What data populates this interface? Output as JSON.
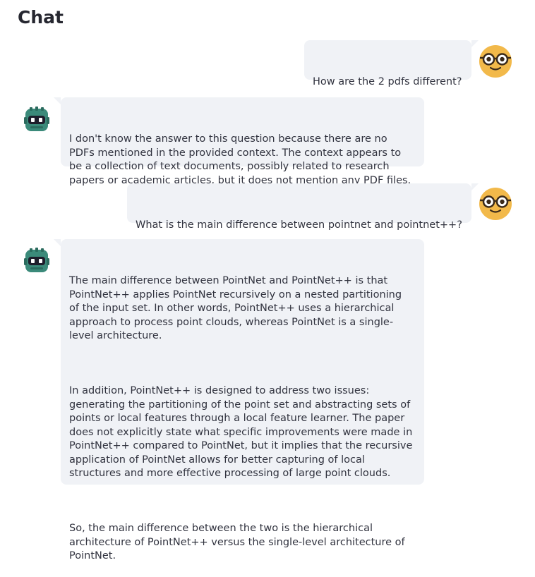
{
  "page": {
    "title": "Chat"
  },
  "colors": {
    "bubble_bg": "#f0f2f6",
    "user_avatar_face": "#f2b94a",
    "bot_avatar_face": "#3b8a7a",
    "text": "#31333f"
  },
  "messages": [
    {
      "role": "user",
      "avatar_icon": "nerd-glasses-face-icon",
      "paragraphs": [
        "How are the 2 pdfs different?"
      ]
    },
    {
      "role": "assistant",
      "avatar_icon": "robot-face-icon",
      "paragraphs": [
        "I don't know the answer to this question because there are no\nPDFs mentioned in the provided context. The context appears to\nbe a collection of text documents, possibly related to research\npapers or academic articles, but it does not mention any PDF files."
      ]
    },
    {
      "role": "user",
      "avatar_icon": "nerd-glasses-face-icon",
      "paragraphs": [
        "What is the main difference between pointnet and pointnet++?"
      ]
    },
    {
      "role": "assistant",
      "avatar_icon": "robot-face-icon",
      "paragraphs": [
        "The main difference between PointNet and PointNet++ is that\nPointNet++ applies PointNet recursively on a nested partitioning\nof the input set. In other words, PointNet++ uses a hierarchical\napproach to process point clouds, whereas PointNet is a single-\nlevel architecture.",
        "In addition, PointNet++ is designed to address two issues:\ngenerating the partitioning of the point set and abstracting sets of\npoints or local features through a local feature learner. The paper\ndoes not explicitly state what specific improvements were made in\nPointNet++ compared to PointNet, but it implies that the recursive\napplication of PointNet allows for better capturing of local\nstructures and more effective processing of large point clouds.",
        "So, the main difference between the two is the hierarchical\narchitecture of PointNet++ versus the single-level architecture of\nPointNet."
      ]
    }
  ]
}
